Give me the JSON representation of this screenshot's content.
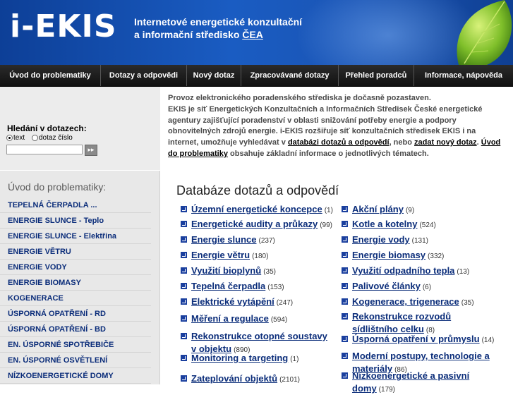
{
  "header": {
    "logo": "i-EKIS",
    "tagline_line1": "Internetové energetické konzultační",
    "tagline_line2": "a informační středisko",
    "tagline_badge": "ČEA"
  },
  "nav": {
    "items": [
      {
        "label": "Úvod do problematiky"
      },
      {
        "label": "Dotazy a odpovědi"
      },
      {
        "label": "Nový dotaz"
      },
      {
        "label": "Zpracovávané dotazy"
      },
      {
        "label": "Přehled poradců"
      },
      {
        "label": "Informace, nápověda"
      }
    ]
  },
  "search": {
    "title": "Hledání v dotazech:",
    "radio_text": "text",
    "radio_number": "dotaz číslo",
    "input_value": "",
    "go_icon": "arrow-right-icon"
  },
  "info": {
    "line1": "Provoz elektronického poradenského střediska je dočasně pozastaven.",
    "line2_pre": "EKIS je síť Energetických Konzultačních a Informačních Středisek České energetické agentury zajišťující poradenství v oblasti snižování potřeby energie a podpory obnovitelných zdrojů energie. i-EKIS rozšiřuje síť konzultačních středisek EKIS i na internet, umožňuje vyhledávat v ",
    "link1": "databázi dotazů a odpovědí",
    "mid1": ", nebo ",
    "link2": "zadat nový dotaz",
    "mid2": ". ",
    "link3": "Úvod do problematiky",
    "post": " obsahuje základní informace o jednotlivých tématech."
  },
  "sidebar": {
    "title": "Úvod do problematiky:",
    "items": [
      "TEPELNÁ ČERPADLA ...",
      "ENERGIE SLUNCE - Teplo",
      "ENERGIE SLUNCE - Elektřina",
      "ENERGIE VĚTRU",
      "ENERGIE VODY",
      "ENERGIE BIOMASY",
      "KOGENERACE",
      "ÚSPORNÁ OPATŘENÍ - RD",
      "ÚSPORNÁ OPATŘENÍ - BD",
      "EN. ÚSPORNÉ SPOTŘEBIČE",
      "EN. ÚSPORNÉ OSVĚTLENÍ",
      "NÍZKOENERGETICKÉ DOMY"
    ]
  },
  "main": {
    "title": "Databáze dotazů a odpovědí",
    "left_topics": [
      {
        "name": "Územní energetické koncepce",
        "count": "(1)"
      },
      {
        "name": "Energetické audity a průkazy",
        "count": "(99)"
      },
      {
        "name": "Energie slunce",
        "count": "(237)"
      },
      {
        "name": "Energie větru",
        "count": "(180)"
      },
      {
        "name": "Využití bioplynů",
        "count": "(35)"
      },
      {
        "name": "Tepelná čerpadla",
        "count": "(153)"
      },
      {
        "name": "Elektrické vytápění",
        "count": "(247)"
      },
      {
        "name": "Měření a regulace",
        "count": "(594)"
      },
      {
        "name": "Rekonstrukce otopné soustavy v objektu",
        "count": "(890)"
      },
      {
        "name": "Monitoring a targeting",
        "count": "(1)"
      },
      {
        "name": "Zateplování objektů",
        "count": "(2101)"
      }
    ],
    "right_topics": [
      {
        "name": "Akční plány",
        "count": "(9)"
      },
      {
        "name": "Kotle a kotelny",
        "count": "(524)"
      },
      {
        "name": "Energie vody",
        "count": "(131)"
      },
      {
        "name": "Energie biomasy",
        "count": "(332)"
      },
      {
        "name": "Využití odpadního tepla",
        "count": "(13)"
      },
      {
        "name": "Palivové články",
        "count": "(6)"
      },
      {
        "name": "Kogenerace, trigenerace",
        "count": "(35)"
      },
      {
        "name": "Rekonstrukce rozvodů sídlištního celku",
        "count": "(8)"
      },
      {
        "name": "Úsporná opatření v průmyslu",
        "count": "(14)"
      },
      {
        "name": "Moderní postupy, technologie a materiály",
        "count": "(86)"
      },
      {
        "name": "Nízkoenergetické a pasivní domy",
        "count": "(179)"
      }
    ]
  },
  "colors": {
    "header_blue": "#1a5cc2",
    "nav_black": "#111111",
    "link_blue": "#0b2d7a",
    "sidebar_gray": "#e8e8e8"
  }
}
